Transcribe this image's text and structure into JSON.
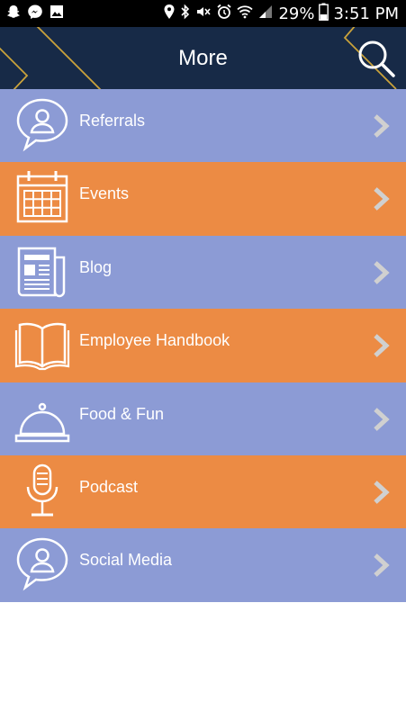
{
  "status_bar": {
    "battery": "29%",
    "time": "3:51 PM"
  },
  "header": {
    "title": "More",
    "search_icon": "search-icon",
    "background": "#172a47",
    "accent": "#c9a23b"
  },
  "colors": {
    "purple": "#8c9bd5",
    "orange": "#ec8b44"
  },
  "menu": [
    {
      "label": "Referrals",
      "icon": "speech-bubble-person-icon",
      "color": "purple"
    },
    {
      "label": "Events",
      "icon": "calendar-icon",
      "color": "orange"
    },
    {
      "label": "Blog",
      "icon": "newspaper-icon",
      "color": "purple"
    },
    {
      "label": "Employee Handbook",
      "icon": "open-book-icon",
      "color": "orange"
    },
    {
      "label": "Food & Fun",
      "icon": "service-bell-icon",
      "color": "purple"
    },
    {
      "label": "Podcast",
      "icon": "microphone-icon",
      "color": "orange"
    },
    {
      "label": "Social Media",
      "icon": "speech-bubble-person-icon",
      "color": "purple"
    }
  ]
}
